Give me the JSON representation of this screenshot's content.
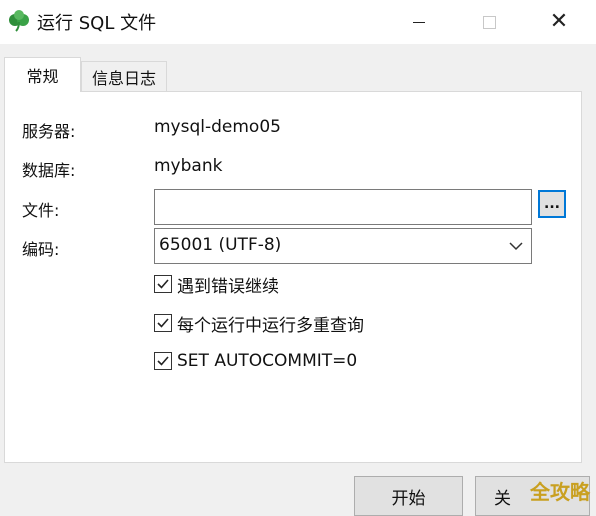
{
  "window": {
    "title": "运行 SQL 文件"
  },
  "tabs": [
    {
      "label": "常规",
      "active": true
    },
    {
      "label": "信息日志",
      "active": false
    }
  ],
  "form": {
    "server_label": "服务器:",
    "server_value": "mysql-demo05",
    "database_label": "数据库:",
    "database_value": "mybank",
    "file_label": "文件:",
    "file_value": "",
    "browse_label": "...",
    "encoding_label": "编码:",
    "encoding_value": "65001 (UTF-8)"
  },
  "options": [
    {
      "label": "遇到错误继续",
      "checked": true
    },
    {
      "label": "每个运行中运行多重查询",
      "checked": true
    },
    {
      "label": "SET AUTOCOMMIT=0",
      "checked": true
    }
  ],
  "buttons": {
    "start_label": "开始",
    "close_label": "关"
  },
  "watermark": "全攻略",
  "colors": {
    "accent": "#0078d7",
    "logo": "#2f8f3a"
  }
}
